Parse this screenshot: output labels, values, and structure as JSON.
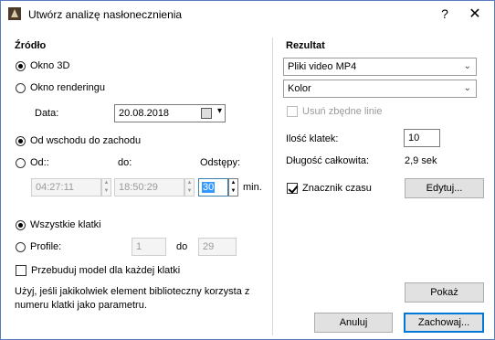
{
  "window": {
    "title": "Utwórz analizę nasłonecznienia",
    "help": "?",
    "close": "✕"
  },
  "source": {
    "heading": "Źródło",
    "okno3d": "Okno 3D",
    "okno_rendering": "Okno renderingu",
    "data_label": "Data:",
    "data_value": "20.08.2018",
    "sunrise": "Od wschodu do zachodu",
    "from_label": "Od::",
    "to_label": "do:",
    "interval_label": "Odstępy:",
    "from_value": "04:27:11",
    "to_value": "18:50:29",
    "interval_value": "30",
    "min_label": "min.",
    "all_frames": "Wszystkie klatki",
    "profile": "Profile:",
    "profile_from": "1",
    "profile_to_label": "do",
    "profile_to": "29",
    "rebuild": "Przebuduj model dla każdej klatki",
    "note": "Użyj, jeśli jakikolwiek element biblioteczny korzysta z numeru klatki jako parametru."
  },
  "result": {
    "heading": "Rezultat",
    "format": "Pliki video MP4",
    "color": "Kolor",
    "remove_lines": "Usuń zbędne linie",
    "frames_label": "Ilość klatek:",
    "frames_value": "10",
    "length_label": "Długość całkowita:",
    "length_value": "2,9 sek",
    "timestamp": "Znacznik czasu",
    "edit": "Edytuj...",
    "show": "Pokaż"
  },
  "footer": {
    "cancel": "Anuluj",
    "save": "Zachowaj..."
  }
}
